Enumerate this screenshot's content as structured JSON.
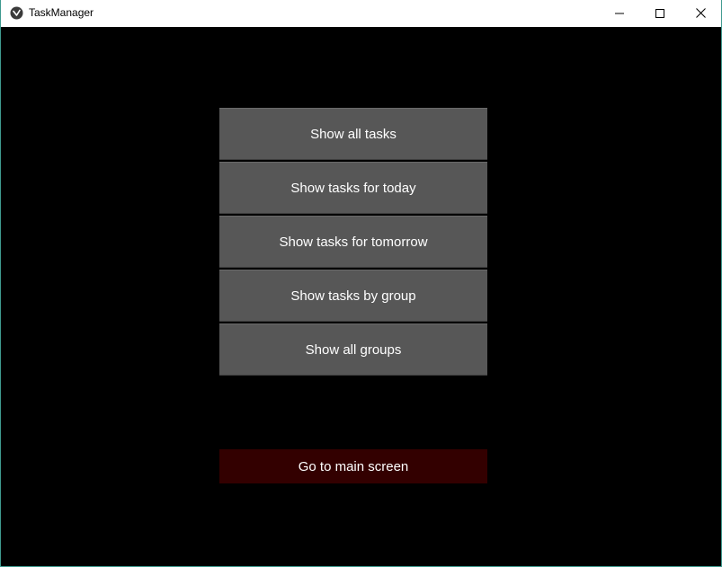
{
  "window": {
    "title": "TaskManager",
    "controls": {
      "minimize": "minimize-icon",
      "maximize": "maximize-icon",
      "close": "close-icon"
    }
  },
  "menu": {
    "buttons": [
      {
        "label": "Show all tasks"
      },
      {
        "label": "Show tasks for today"
      },
      {
        "label": "Show tasks for tomorrow"
      },
      {
        "label": "Show tasks by group"
      },
      {
        "label": "Show all groups"
      }
    ],
    "main_screen_label": "Go to main screen"
  },
  "colors": {
    "background": "#000000",
    "button": "#575757",
    "main_screen_button": "#330000",
    "text": "#ffffff"
  }
}
